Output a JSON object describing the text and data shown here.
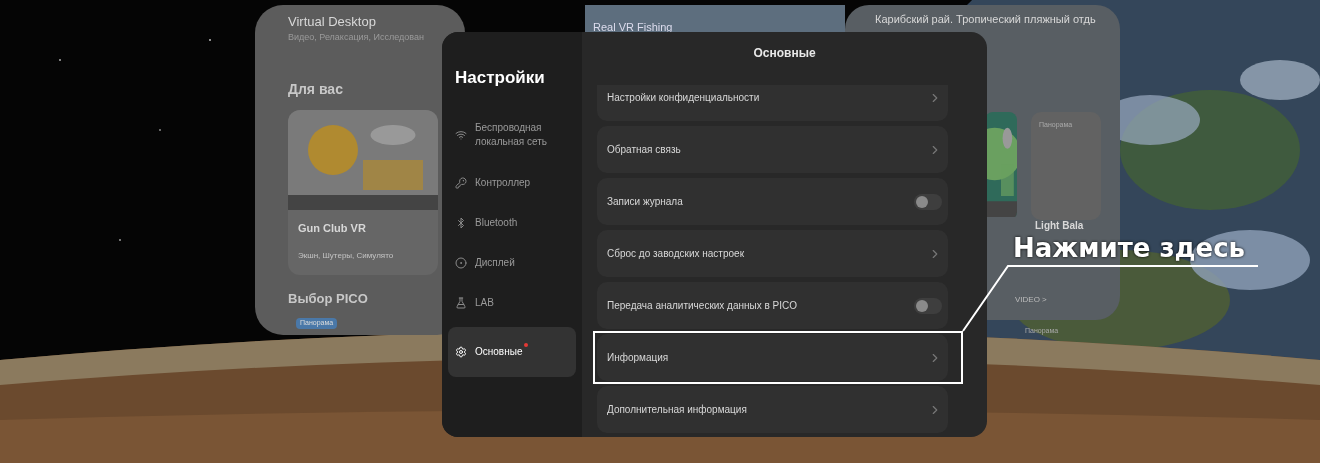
{
  "background_apps": {
    "left_panel": {
      "title": "Virtual Desktop",
      "subtitle": "Видео, Релаксация, Исследован",
      "section_1": "Для вас",
      "card_title": "Gun Club VR",
      "card_tags": "Экшн, Шутеры, Симулято",
      "section_2": "Выбор PICO",
      "badge": "Панорама"
    },
    "center_panel": {
      "title": "Real VR Fishing"
    },
    "right_panel": {
      "title": "Карибский рай. Тропический пляжный отдь",
      "badge_1": "Панорама",
      "card_title": "Light Bala",
      "link": "VIDEO >",
      "badge_2": "Панорама"
    }
  },
  "settings": {
    "title": "Настройки",
    "header": "Основные",
    "nav": [
      {
        "label": "Беспроводная локальная сеть",
        "selected": false,
        "notification": false
      },
      {
        "label": "Контроллер",
        "selected": false,
        "notification": false
      },
      {
        "label": "Bluetooth",
        "selected": false,
        "notification": false
      },
      {
        "label": "Дисплей",
        "selected": false,
        "notification": false
      },
      {
        "label": "LAB",
        "selected": false,
        "notification": false
      },
      {
        "label": "Основные",
        "selected": true,
        "notification": true
      }
    ],
    "rows": [
      {
        "label": "Настройки конфиденциальности",
        "kind": "link",
        "highlighted": false
      },
      {
        "label": "Обратная связь",
        "kind": "link",
        "highlighted": false
      },
      {
        "label": "Записи журнала",
        "kind": "toggle",
        "on": false,
        "highlighted": false
      },
      {
        "label": "Сброс до заводских настроек",
        "kind": "link",
        "highlighted": false
      },
      {
        "label": "Передача аналитических данных в PICO",
        "kind": "toggle",
        "on": false,
        "highlighted": false
      },
      {
        "label": "Информация",
        "kind": "link",
        "highlighted": true
      },
      {
        "label": "Дополнительная информация",
        "kind": "link",
        "highlighted": false
      }
    ]
  },
  "callout": {
    "text": "Нажмите здесь"
  }
}
